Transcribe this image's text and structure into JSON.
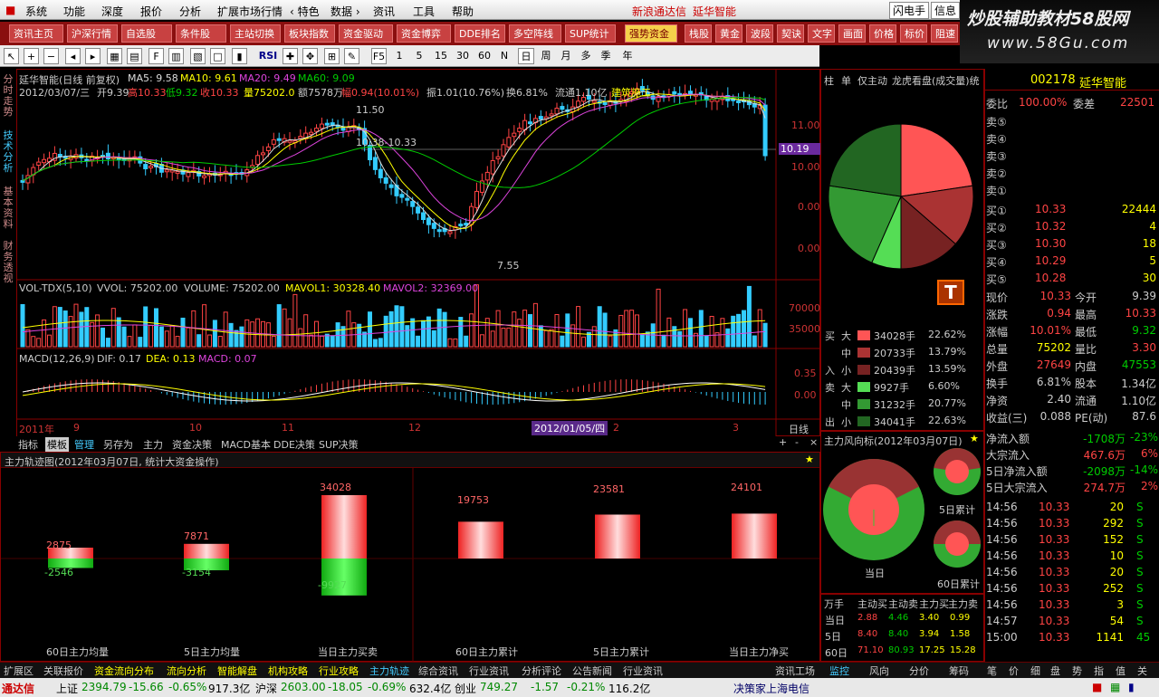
{
  "menu": {
    "items": [
      "系统",
      "功能",
      "深度",
      "报价",
      "分析",
      "扩展市场行情",
      "‹ 特色",
      "数据 ›",
      "资讯",
      "工具",
      "帮助"
    ],
    "brand": "新浪通达信",
    "stock": "延华智能",
    "right1": "闪电手",
    "right2": "信息"
  },
  "watermark": {
    "line1": "炒股辅助教材58股网",
    "line2": "www.58Gu.com"
  },
  "tabs": [
    "资讯主页",
    "沪深行情",
    "自选股",
    "条件股",
    "主站切换",
    "板块指数",
    "资金驱动",
    "资金博弈",
    "DDE排名",
    "多空阵线",
    "SUP统计",
    "强势资金",
    "栈股",
    "黄金",
    "波段",
    "契诀",
    "文字",
    "画面",
    "价格",
    "标价",
    "阻速",
    "翻"
  ],
  "toolbar": {
    "periods": [
      "F5",
      "1",
      "5",
      "15",
      "30",
      "60",
      "N",
      "日",
      "周",
      "月",
      "多",
      "季",
      "年"
    ],
    "rsi": "RSI"
  },
  "leftvtabs": [
    "分时走势",
    "技术分析",
    "基本资料",
    "财务透视"
  ],
  "chart": {
    "title": "延华智能(日线 前复权)",
    "ma5": "MA5: 9.58",
    "ma10": "MA10: 9.61",
    "ma20": "MA20: 9.49",
    "ma60": "MA60: 9.09",
    "info_date": "2012/03/07/三",
    "info_open": "开9.39",
    "info_high": "高10.33",
    "info_low": "低9.32",
    "info_close": "收10.33",
    "info_vol": "量75202.0",
    "info_amt": "额7578万",
    "info_chg": "幅0.94(10.01%)",
    "info_amp": "振1.01(10.76%)",
    "info_turn": "换6.81%",
    "info_float": "流通1.10亿",
    "info_sector": "建筑施工",
    "hi_label": "11.50",
    "mid_label": "10.38-10.33",
    "lo_label": "7.55",
    "price_tag": "10.19",
    "y_labels": [
      "11.00",
      "10.00",
      "0.00",
      "0.00"
    ],
    "vol_title": "VOL-TDX(5,10)",
    "vol_vvol": "VVOL: 75202.00",
    "vol_vol": "VOLUME: 75202.00",
    "vol_mavol1": "MAVOL1: 30328.40",
    "vol_mavol2": "MAVOL2: 32369.00",
    "vol_y": [
      "70000",
      "35000"
    ],
    "macd_title": "MACD(12,26,9)",
    "macd_dif": "DIF: 0.17",
    "macd_dea": "DEA: 0.13",
    "macd_macd": "MACD: 0.07",
    "macd_y": [
      "0.35",
      "0.00"
    ],
    "x_labels": [
      "2011年",
      "9",
      "10",
      "11",
      "12",
      "2",
      "3"
    ],
    "x_date_tag": "2012/01/05/四",
    "x_right": "日线"
  },
  "bottomtabs": [
    "指标",
    "模板",
    "管理",
    "另存为",
    "主力",
    "资金决策",
    "MACD基本",
    "DDE决策",
    "SUP决策"
  ],
  "track": {
    "title": "主力轨迹图(2012年03月07日, 统计大资金操作)",
    "bars_left": [
      {
        "up": "2875",
        "down": "-2546",
        "label": "60日主力均量"
      },
      {
        "up": "7871",
        "down": "-3154",
        "label": "5日主力均量"
      },
      {
        "up": "34028",
        "down": "-9927",
        "label": "当日主力买卖"
      }
    ],
    "bars_right": [
      {
        "up": "19753",
        "label": "60日主力累计"
      },
      {
        "up": "23581",
        "label": "5日主力累计"
      },
      {
        "up": "24101",
        "label": "当日主力净买"
      }
    ]
  },
  "pie_header": [
    "柱",
    "单",
    "仅主动",
    "龙虎看盘(成交量)统"
  ],
  "pie_logo": "T",
  "flow": {
    "buy": "买入",
    "sell": "卖出",
    "rows": [
      {
        "side": "买",
        "size": "大",
        "vol": "34028手",
        "pct": "22.62%",
        "color": "#f55"
      },
      {
        "side": "",
        "size": "中",
        "vol": "20733手",
        "pct": "13.79%",
        "color": "#a33"
      },
      {
        "side": "入",
        "size": "小",
        "vol": "20439手",
        "pct": "13.59%",
        "color": "#722"
      },
      {
        "side": "卖",
        "size": "大",
        "vol": "9927手",
        "pct": "6.60%",
        "color": "#5d5"
      },
      {
        "side": "",
        "size": "中",
        "vol": "31232手",
        "pct": "20.77%",
        "color": "#393"
      },
      {
        "side": "出",
        "size": "小",
        "vol": "34041手",
        "pct": "22.63%",
        "color": "#262"
      }
    ]
  },
  "wind": {
    "title": "主力风向标(2012年03月07日)",
    "today": "当日",
    "d5": "5日累计",
    "d60": "60日累计"
  },
  "mini": {
    "header": [
      "万手",
      "主动买",
      "主动卖",
      "主力买",
      "主力卖"
    ],
    "rows": [
      {
        "k": "当日",
        "v": [
          "2.88",
          "4.46",
          "3.40",
          "0.99"
        ]
      },
      {
        "k": "5日",
        "v": [
          "8.40",
          "8.40",
          "3.94",
          "1.58"
        ]
      },
      {
        "k": "60日",
        "v": [
          "71.10",
          "80.93",
          "17.25",
          "15.28"
        ]
      }
    ]
  },
  "quote": {
    "code": "002178",
    "name": "延华智能",
    "wb_label": "委比",
    "wb": "100.00%",
    "wc_label": "委差",
    "wc": "22501",
    "sells": [
      "卖⑤",
      "卖④",
      "卖③",
      "卖②",
      "卖①"
    ],
    "buys": [
      {
        "l": "买①",
        "p": "10.33",
        "v": "22444"
      },
      {
        "l": "买②",
        "p": "10.32",
        "v": "4"
      },
      {
        "l": "买③",
        "p": "10.30",
        "v": "18"
      },
      {
        "l": "买④",
        "p": "10.29",
        "v": "5"
      },
      {
        "l": "买⑤",
        "p": "10.28",
        "v": "30"
      }
    ],
    "stats": [
      {
        "l": "现价",
        "v": "10.33",
        "l2": "今开",
        "v2": "9.39"
      },
      {
        "l": "涨跌",
        "v": "0.94",
        "l2": "最高",
        "v2": "10.33"
      },
      {
        "l": "涨幅",
        "v": "10.01%",
        "l2": "最低",
        "v2": "9.32"
      },
      {
        "l": "总量",
        "v": "75202",
        "l2": "量比",
        "v2": "3.30"
      },
      {
        "l": "外盘",
        "v": "27649",
        "l2": "内盘",
        "v2": "47553"
      },
      {
        "l": "换手",
        "v": "6.81%",
        "l2": "股本",
        "v2": "1.34亿"
      },
      {
        "l": "净资",
        "v": "2.40",
        "l2": "流通",
        "v2": "1.10亿"
      },
      {
        "l": "收益(三)",
        "v": "0.088",
        "l2": "PE(动)",
        "v2": "87.6"
      }
    ],
    "flows": [
      {
        "l": "净流入额",
        "v": "-1708万",
        "p": "-23%"
      },
      {
        "l": "大宗流入",
        "v": "467.6万",
        "p": "6%"
      },
      {
        "l": "5日净流入额",
        "v": "-2098万",
        "p": "-14%"
      },
      {
        "l": "5日大宗流入",
        "v": "274.7万",
        "p": "2%"
      }
    ],
    "ticks": [
      {
        "t": "14:56",
        "p": "10.33",
        "v": "20",
        "s": "S"
      },
      {
        "t": "14:56",
        "p": "10.33",
        "v": "292",
        "s": "S"
      },
      {
        "t": "14:56",
        "p": "10.33",
        "v": "152",
        "s": "S"
      },
      {
        "t": "14:56",
        "p": "10.33",
        "v": "10",
        "s": "S"
      },
      {
        "t": "14:56",
        "p": "10.33",
        "v": "20",
        "s": "S"
      },
      {
        "t": "14:56",
        "p": "10.33",
        "v": "252",
        "s": "S"
      },
      {
        "t": "14:56",
        "p": "10.33",
        "v": "3",
        "s": "S"
      },
      {
        "t": "14:57",
        "p": "10.33",
        "v": "54",
        "s": "S"
      },
      {
        "t": "15:00",
        "p": "10.33",
        "v": "1141",
        "s": "45"
      }
    ]
  },
  "statusbar": [
    "扩展区",
    "关联报价",
    "资金流向分布",
    "流向分析",
    "智能解盘",
    "机构攻略",
    "行业攻略",
    "主力轨迹",
    "综合资讯",
    "行业资讯",
    "分析评论",
    "公告新闻",
    "行业资讯",
    "资讯工场",
    "监控",
    "风向",
    "分价",
    "筹码",
    "笔",
    "价",
    "细",
    "盘",
    "势",
    "指",
    "值",
    "关"
  ],
  "ticker": {
    "brand": "通达信",
    "sh_l": "上证",
    "sh": "2394.79",
    "sh_c": "-15.66",
    "sh_p": "-0.65%",
    "sh_a": "917.3亿",
    "sz_l": "沪深",
    "sz": "2603.00",
    "sz_c": "-18.05",
    "sz_p": "-0.69%",
    "sz_a": "632.4亿",
    "cy_l": "创业",
    "cy": "749.27",
    "cy_c": "-1.57",
    "cy_p": "-0.21%",
    "cy_a": "116.2亿",
    "news": "决策家上海电信"
  }
}
